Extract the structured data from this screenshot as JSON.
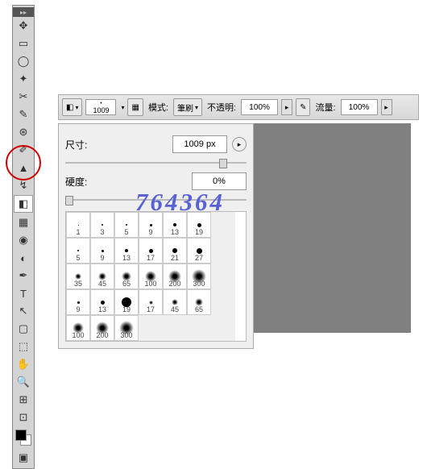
{
  "toolbar": {
    "header": "▸▸"
  },
  "options": {
    "brush_size": "1009",
    "mode_label": "模式:",
    "mode_value": "筆刷",
    "opacity_label": "不透明:",
    "opacity_value": "100%",
    "flow_label": "流量:",
    "flow_value": "100%"
  },
  "panel": {
    "size_label": "尺寸:",
    "size_value": "1009 px",
    "hardness_label": "硬度:",
    "hardness_value": "0%"
  },
  "brushes_row1": [
    "1",
    "3",
    "5",
    "9",
    "13",
    "19",
    ""
  ],
  "brushes_row2": [
    "5",
    "9",
    "13",
    "17",
    "21",
    "27",
    ""
  ],
  "brushes_row3": [
    "35",
    "45",
    "65",
    "100",
    "200",
    "300",
    ""
  ],
  "brushes_row4": [
    "9",
    "13",
    "19",
    "17",
    "45",
    "65",
    ""
  ],
  "brushes_row5": [
    "100",
    "200",
    "300",
    "",
    "",
    "",
    ""
  ],
  "watermark": "764364"
}
